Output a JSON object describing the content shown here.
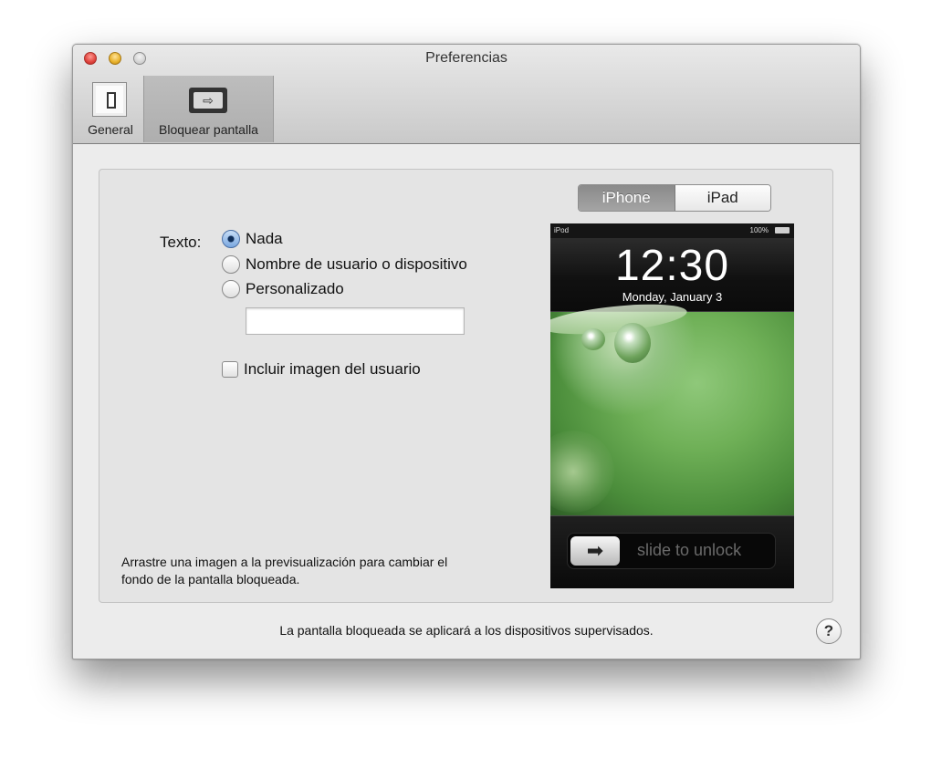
{
  "window": {
    "title": "Preferencias"
  },
  "toolbar": {
    "items": [
      {
        "label": "General",
        "icon": "switch-icon"
      },
      {
        "label": "Bloquear pantalla",
        "icon": "lock-screen-icon",
        "selected": true
      }
    ]
  },
  "form": {
    "text_label": "Texto:",
    "options": [
      {
        "label": "Nada",
        "selected": true
      },
      {
        "label": "Nombre de usuario o dispositivo",
        "selected": false
      },
      {
        "label": "Personalizado",
        "selected": false
      }
    ],
    "custom_value": "",
    "include_image_label": "Incluir imagen del usuario",
    "include_image_checked": false
  },
  "preview": {
    "segments": [
      "iPhone",
      "iPad"
    ],
    "selected_segment": "iPhone",
    "status": {
      "carrier": "iPod",
      "battery": "100%"
    },
    "time": "12:30",
    "date": "Monday, January 3",
    "slider_text": "slide to unlock"
  },
  "hint": "Arrastre una imagen a la previsualización para cambiar el fondo de la pantalla bloqueada.",
  "footer": {
    "message": "La pantalla bloqueada se aplicará a los dispositivos supervisados.",
    "help_label": "?"
  },
  "colors": {
    "segment_selected": "#9a9a9a",
    "accent_radio": "#7aa7e0"
  }
}
